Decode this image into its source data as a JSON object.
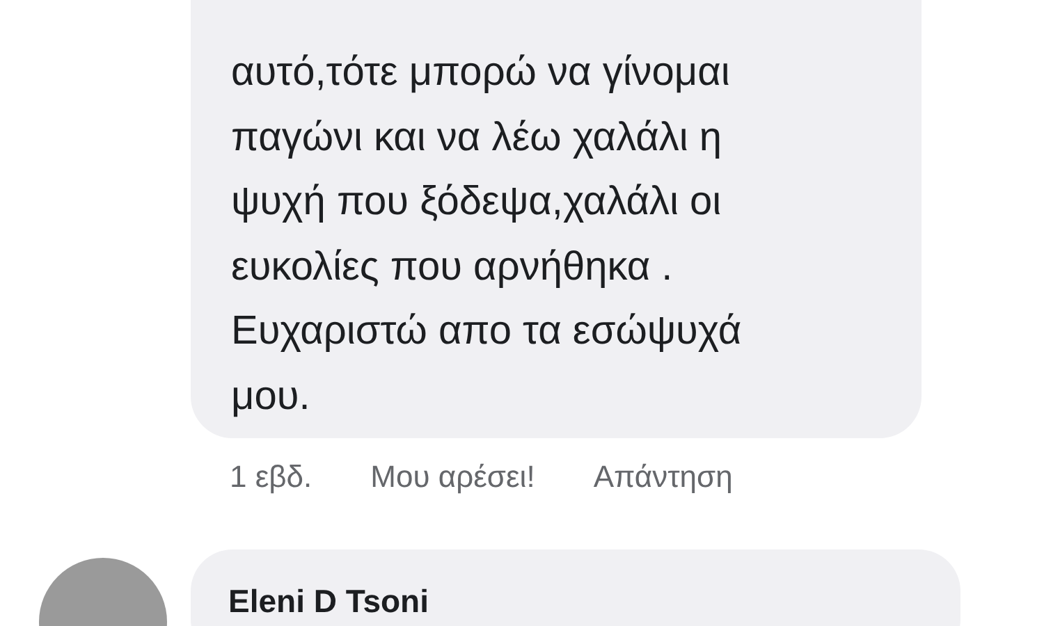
{
  "comments": [
    {
      "lines": [
        "αυτό,τότε μπορώ να γίνομαι",
        "παγώνι και να λέω χαλάλι η",
        "ψυχή που ξόδεψα,χαλάλι οι",
        "ευκολίες που αρνήθηκα .",
        "Ευχαριστώ απο τα εσώψυχά",
        "μου."
      ],
      "time": "1 εβδ.",
      "actions": [
        "Μου αρέσει!",
        "Απάντηση"
      ]
    },
    {
      "author": "Eleni D Tsoni"
    }
  ]
}
